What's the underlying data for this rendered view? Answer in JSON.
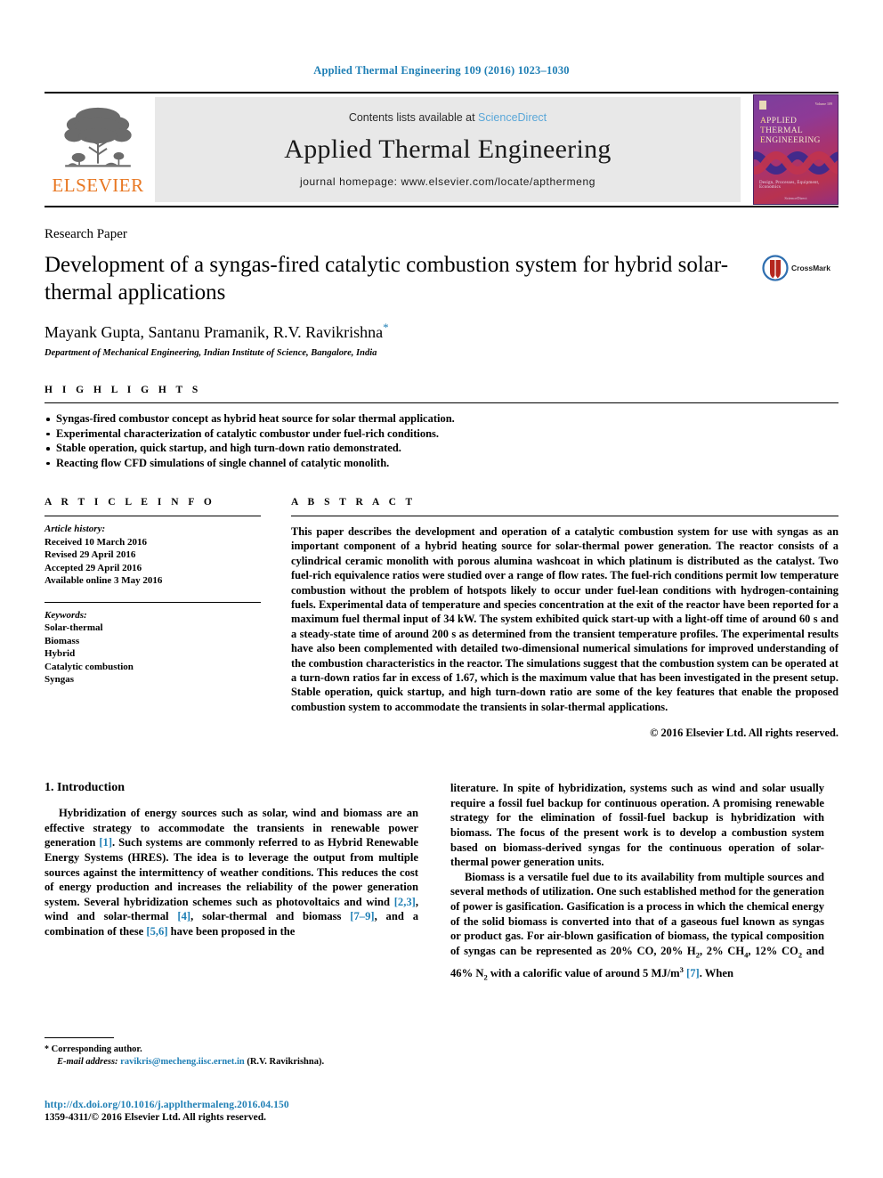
{
  "running_head": "Applied Thermal Engineering 109 (2016) 1023–1030",
  "masthead": {
    "publisher": "ELSEVIER",
    "contents_prefix": "Contents lists available at ",
    "sciencedirect": "ScienceDirect",
    "journal_title": "Applied Thermal Engineering",
    "homepage": "journal homepage: www.elsevier.com/locate/apthermeng",
    "cover": {
      "line1": "APPLIED",
      "line2": "THERMAL",
      "line3": "ENGINEERING",
      "tagline": "Design, Processes, Equipment, Economics",
      "issue": "Volume 109",
      "footer": "ScienceDirect"
    }
  },
  "article": {
    "type": "Research Paper",
    "title": "Development of a syngas-fired catalytic combustion system for hybrid solar-thermal applications",
    "crossmark_label": "CrossMark",
    "authors": "Mayank Gupta, Santanu Pramanik, R.V. Ravikrishna",
    "author_star": "*",
    "affiliation": "Department of Mechanical Engineering, Indian Institute of Science, Bangalore, India"
  },
  "highlights": {
    "label": "H I G H L I G H T S",
    "items": [
      "Syngas-fired combustor concept as hybrid heat source for solar thermal application.",
      "Experimental characterization of catalytic combustor under fuel-rich conditions.",
      "Stable operation, quick startup, and high turn-down ratio demonstrated.",
      "Reacting flow CFD simulations of single channel of catalytic monolith."
    ]
  },
  "article_info": {
    "label": "A R T I C L E   I N F O",
    "history_label": "Article history:",
    "history": [
      "Received 10 March 2016",
      "Revised 29 April 2016",
      "Accepted 29 April 2016",
      "Available online 3 May 2016"
    ],
    "keywords_label": "Keywords:",
    "keywords": [
      "Solar-thermal",
      "Biomass",
      "Hybrid",
      "Catalytic combustion",
      "Syngas"
    ]
  },
  "abstract": {
    "label": "A B S T R A C T",
    "text": "This paper describes the development and operation of a catalytic combustion system for use with syngas as an important component of a hybrid heating source for solar-thermal power generation. The reactor consists of a cylindrical ceramic monolith with porous alumina washcoat in which platinum is distributed as the catalyst. Two fuel-rich equivalence ratios were studied over a range of flow rates. The fuel-rich conditions permit low temperature combustion without the problem of hotspots likely to occur under fuel-lean conditions with hydrogen-containing fuels. Experimental data of temperature and species concentration at the exit of the reactor have been reported for a maximum fuel thermal input of 34 kW. The system exhibited quick start-up with a light-off time of around 60 s and a steady-state time of around 200 s as determined from the transient temperature profiles. The experimental results have also been complemented with detailed two-dimensional numerical simulations for improved understanding of the combustion characteristics in the reactor. The simulations suggest that the combustion system can be operated at a turn-down ratios far in excess of 1.67, which is the maximum value that has been investigated in the present setup. Stable operation, quick startup, and high turn-down ratio are some of the key features that enable the proposed combustion system to accommodate the transients in solar-thermal applications.",
    "rights": "© 2016 Elsevier Ltd. All rights reserved."
  },
  "introduction": {
    "heading": "1. Introduction",
    "left_p1_a": "Hybridization of energy sources such as solar, wind and biomass are an effective strategy to accommodate the transients in renewable power generation ",
    "cite1": "[1]",
    "left_p1_b": ". Such systems are commonly referred to as Hybrid Renewable Energy Systems (HRES). The idea is to leverage the output from multiple sources against the intermittency of weather conditions. This reduces the cost of energy production and increases the reliability of the power generation system. Several hybridization schemes such as photovoltaics and wind ",
    "cite2": "[2,3]",
    "left_p1_c": ", wind and solar-thermal ",
    "cite3": "[4]",
    "left_p1_d": ", solar-thermal and biomass ",
    "cite4": "[7–9]",
    "left_p1_e": ", and a combination of these ",
    "cite5": "[5,6]",
    "left_p1_f": " have been proposed in the",
    "right_p1": "literature. In spite of hybridization, systems such as wind and solar usually require a fossil fuel backup for continuous operation. A promising renewable strategy for the elimination of fossil-fuel backup is hybridization with biomass. The focus of the present work is to develop a combustion system based on biomass-derived syngas for the continuous operation of solar-thermal power generation units.",
    "right_p2_a": "Biomass is a versatile fuel due to its availability from multiple sources and several methods of utilization. One such established method for the generation of power is gasification. Gasification is a process in which the chemical energy of the solid biomass is converted into that of a gaseous fuel known as syngas or product gas. For air-blown gasification of biomass, the typical composition of syngas can be represented as 20% CO, 20% H",
    "sub_h2": "2",
    "right_p2_b": ", 2% CH",
    "sub_ch4": "4",
    "right_p2_c": ", 12% CO",
    "sub_co2": "2",
    "right_p2_d": " and 46% N",
    "sub_n2": "2",
    "right_p2_e": " with a calorific value of around 5 MJ/m",
    "sup_m3": "3",
    "right_p2_f": " ",
    "cite7": "[7]",
    "right_p2_g": ". When"
  },
  "footnote": {
    "star": "*",
    "corresponding": "Corresponding author.",
    "email_label": "E-mail address:",
    "email": "ravikris@mecheng.iisc.ernet.in",
    "email_owner": "(R.V. Ravikrishna)."
  },
  "footer": {
    "doi": "http://dx.doi.org/10.1016/j.applthermaleng.2016.04.150",
    "issn": "1359-4311/© 2016 Elsevier Ltd. All rights reserved."
  },
  "colors": {
    "link_blue": "#1f7fb5",
    "sciencedirect_blue": "#5aa7d8",
    "elsevier_orange": "#e87722",
    "banner_gray": "#e8e8e8"
  }
}
